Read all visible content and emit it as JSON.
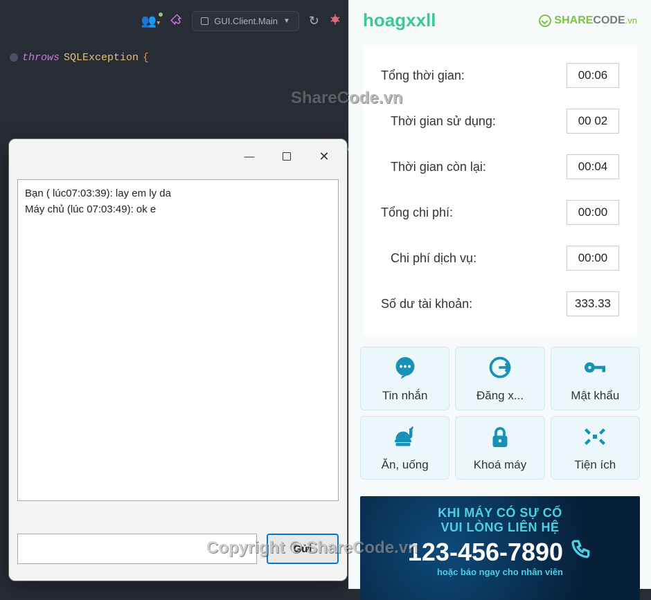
{
  "ide": {
    "run_config": "GUI.Client.Main",
    "code": {
      "throws": "throws",
      "exception": "SQLException",
      "brace": "{"
    }
  },
  "watermarks": {
    "top": "ShareCode.vn",
    "bottom": "Copyright © ShareCode.vn"
  },
  "dialog": {
    "chat_log": "Bạn ( lúc07:03:39): lay em ly da\nMáy chủ (lúc 07:03:49): ok e",
    "input_value": "",
    "send_label": "Gửi"
  },
  "client": {
    "username": "hoagxxll",
    "logo_text_1": "SHARE",
    "logo_text_2": "CODE",
    "logo_suffix": ".vn",
    "info": {
      "total_time_label": "Tổng thời gian:",
      "total_time_value": "00:06",
      "used_time_label": "Thời gian sử dụng:",
      "used_time_value": "00 02",
      "remain_time_label": "Thời gian còn lại:",
      "remain_time_value": "00:04",
      "total_cost_label": "Tổng chi phí:",
      "total_cost_value": "00:00",
      "service_cost_label": "Chi phí dịch vụ:",
      "service_cost_value": "00:00",
      "balance_label": "Số dư tài khoản:",
      "balance_value": "333.33"
    },
    "actions": {
      "message": "Tin nhắn",
      "logout": "Đăng x...",
      "password": "Mật khẩu",
      "food": "Ăn, uống",
      "lock": "Khoá máy",
      "utility": "Tiện ích"
    },
    "banner": {
      "line1": "KHI MÁY CÓ SỰ CỐ",
      "line2": "VUI LÒNG LIÊN HỆ",
      "phone": "123-456-7890",
      "line3": "hoặc báo ngay cho nhân viên"
    }
  }
}
